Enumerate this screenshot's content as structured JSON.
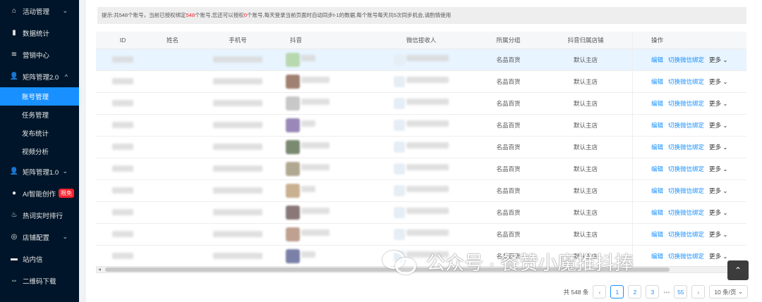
{
  "sidebar": {
    "items": [
      {
        "label": "活动管理",
        "icon": "home-icon",
        "chevron": "⌄"
      },
      {
        "label": "数据统计",
        "icon": "bar-chart-icon"
      },
      {
        "label": "营销中心",
        "icon": "layers-icon"
      },
      {
        "label": "矩阵管理2.0",
        "icon": "user-icon",
        "chevron": "^"
      },
      {
        "label": "账号管理",
        "sub": true,
        "active": true
      },
      {
        "label": "任务管理",
        "sub": true
      },
      {
        "label": "发布统计",
        "sub": true
      },
      {
        "label": "视频分析",
        "sub": true
      },
      {
        "label": "矩阵管理1.0",
        "icon": "user-icon",
        "chevron": "⌄"
      },
      {
        "label": "AI智能创作",
        "icon": "ai-icon",
        "badge": "限免"
      },
      {
        "label": "热词实时排行",
        "icon": "fire-icon"
      },
      {
        "label": "店铺配置",
        "icon": "settings-icon",
        "chevron": "⌄"
      },
      {
        "label": "站内信",
        "icon": "message-icon"
      },
      {
        "label": "二维码下载",
        "icon": "link-icon"
      }
    ]
  },
  "notice": {
    "part1": "提示:共548个账号，当前已授权绑定",
    "bound": "548",
    "part2": "个账号,您还可以授权",
    "remaining": "0",
    "part3": "个账号,每天登录当前页面时自动同步t-1的数据,每个账号每天共5次同步机会,请酌情使用"
  },
  "table": {
    "headers": {
      "id": "ID",
      "name": "姓名",
      "phone": "手机号",
      "douyin": "抖音",
      "wechat": "微信接收人",
      "group": "所属分组",
      "shop": "抖音归属店铺",
      "ops": "操作"
    },
    "rows": [
      {
        "group": "名品百货",
        "shop": "默认主店"
      },
      {
        "group": "名品百货",
        "shop": "默认主店"
      },
      {
        "group": "名品百货",
        "shop": "默认主店"
      },
      {
        "group": "名品百货",
        "shop": "默认主店"
      },
      {
        "group": "名品百货",
        "shop": "默认主店"
      },
      {
        "group": "名品百货",
        "shop": "默认主店"
      },
      {
        "group": "名品百货",
        "shop": "默认主店"
      },
      {
        "group": "名品百货",
        "shop": "默认主店"
      },
      {
        "group": "名品百货",
        "shop": "默认主店"
      },
      {
        "group": "名品百货",
        "shop": "默认主店"
      }
    ],
    "ops": {
      "edit": "编辑",
      "switch": "切换微信绑定",
      "more": "更多"
    }
  },
  "pagination": {
    "total": "共 548 条",
    "pages": [
      "1",
      "2",
      "3"
    ],
    "last": "55",
    "ellipsis": "•••",
    "prev": "‹",
    "next": "›",
    "size": "10 条/页"
  },
  "watermark": "公众号 · 餐赞小魔推抖捧",
  "colors": {
    "primary": "#1890ff",
    "sidebar": "#001529",
    "danger": "#f5222d"
  }
}
